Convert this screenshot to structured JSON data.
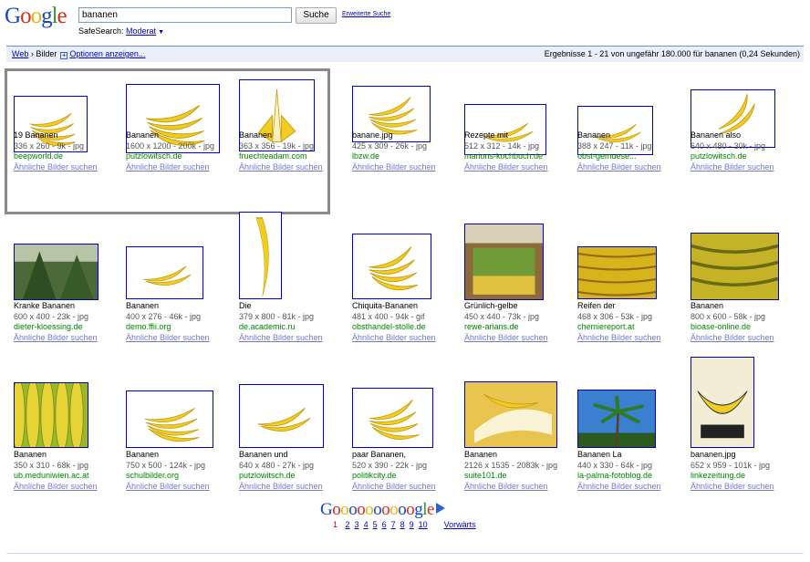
{
  "header": {
    "logo_letters": [
      {
        "ch": "G",
        "color": "#1548c8"
      },
      {
        "ch": "o",
        "color": "#d92a1e"
      },
      {
        "ch": "o",
        "color": "#e8b409"
      },
      {
        "ch": "g",
        "color": "#1548c8"
      },
      {
        "ch": "l",
        "color": "#2a9d2a"
      },
      {
        "ch": "e",
        "color": "#d92a1e"
      }
    ],
    "search_value": "bananen",
    "search_button": "Suche",
    "advanced_link": "Erweiterte Suche",
    "safesearch_label": "SafeSearch: ",
    "safesearch_value": "Moderat"
  },
  "bar": {
    "web_link": "Web",
    "separator": " › ",
    "current": "Bilder",
    "options_link": "Optionen anzeigen...",
    "results_info": "Ergebnisse 1 - 21 von ungefähr 180.000 für bananen (0,24 Sekunden)"
  },
  "results": [
    {
      "title": "19 Bananen",
      "meta": "336 x 260 - 9k - jpg",
      "site": "beepworld.de",
      "similar": "Ähnliche Bilder suchen"
    },
    {
      "title": "Bananen",
      "meta": "1600 x 1200 - 200k - jpg",
      "site": "putzlowitsch.de",
      "similar": "Ähnliche Bilder suchen"
    },
    {
      "title": "Bananen",
      "meta": "363 x 356 - 19k - jpg",
      "site": "fruechteadam.com",
      "similar": "Ähnliche Bilder suchen"
    },
    {
      "title": "banane.jpg",
      "meta": "425 x 309 - 26k - jpg",
      "site": "lbzw.de",
      "similar": "Ähnliche Bilder suchen"
    },
    {
      "title": "Rezepte mit",
      "meta": "512 x 312 - 14k - jpg",
      "site": "marions-kochbuch.de",
      "similar": "Ähnliche Bilder suchen"
    },
    {
      "title": "Bananen",
      "meta": "388 x 247 - 11k - jpg",
      "site": "obst-gemuese...",
      "similar": "Ähnliche Bilder suchen"
    },
    {
      "title": "Bananen also",
      "meta": "640 x 480 - 30k - jpg",
      "site": "putzlowitsch.de",
      "similar": "Ähnliche Bilder suchen"
    },
    {
      "title": "Kranke Bananen",
      "meta": "600 x 400 - 23k - jpg",
      "site": "dieter-kloessing.de",
      "similar": "Ähnliche Bilder suchen"
    },
    {
      "title": "Bananen",
      "meta": "400 x 276 - 46k - jpg",
      "site": "demo.ffii.org",
      "similar": "Ähnliche Bilder suchen"
    },
    {
      "title": "Die",
      "meta": "379 x 800 - 81k - jpg",
      "site": "de.academic.ru",
      "similar": "Ähnliche Bilder suchen"
    },
    {
      "title": "Chiquita-Bananen",
      "meta": "481 x 400 - 94k - gif",
      "site": "obsthandel-stolle.de",
      "similar": "Ähnliche Bilder suchen"
    },
    {
      "title": "Grünlich-gelbe",
      "meta": "450 x 440 - 73k - jpg",
      "site": "rewe-arians.de",
      "similar": "Ähnliche Bilder suchen"
    },
    {
      "title": "Reifen der",
      "meta": "468 x 306 - 53k - jpg",
      "site": "chemiereport.at",
      "similar": "Ähnliche Bilder suchen"
    },
    {
      "title": "Bananen",
      "meta": "800 x 600 - 58k - jpg",
      "site": "bioase-online.de",
      "similar": "Ähnliche Bilder suchen"
    },
    {
      "title": "Bananen",
      "meta": "350 x 310 - 68k - jpg",
      "site": "ub.meduniwien.ac.at",
      "similar": "Ähnliche Bilder suchen"
    },
    {
      "title": "Bananen",
      "meta": "750 x 500 - 124k - jpg",
      "site": "schulbilder.org",
      "similar": "Ähnliche Bilder suchen"
    },
    {
      "title": "Bananen und",
      "meta": "640 x 480 - 27k - jpg",
      "site": "putzlowitsch.de",
      "similar": "Ähnliche Bilder suchen"
    },
    {
      "title": "paar Bananen,",
      "meta": "520 x 390 - 22k - jpg",
      "site": "politikcity.de",
      "similar": "Ähnliche Bilder suchen"
    },
    {
      "title": "Bananen",
      "meta": "2126 x 1535 - 2083k - jpg",
      "site": "suite101.de",
      "similar": "Ähnliche Bilder suchen"
    },
    {
      "title": "Bananen La",
      "meta": "440 x 330 - 64k - jpg",
      "site": "la-palma-fotoblog.de",
      "similar": "Ähnliche Bilder suchen"
    },
    {
      "title": "bananen.jpg",
      "meta": "652 x 959 - 101k - jpg",
      "site": "linkezeitung.de",
      "similar": "Ähnliche Bilder suchen"
    }
  ],
  "pager": {
    "letters": [
      {
        "ch": "G",
        "color": "#1548c8"
      },
      {
        "ch": "o",
        "color": "#d92a1e"
      },
      {
        "ch": "o",
        "color": "#e8b409"
      },
      {
        "ch": "o",
        "color": "#1548c8"
      },
      {
        "ch": "o",
        "color": "#d92a1e"
      },
      {
        "ch": "o",
        "color": "#e8b409"
      },
      {
        "ch": "o",
        "color": "#1548c8"
      },
      {
        "ch": "o",
        "color": "#d92a1e"
      },
      {
        "ch": "o",
        "color": "#e8b409"
      },
      {
        "ch": "o",
        "color": "#1548c8"
      },
      {
        "ch": "o",
        "color": "#d92a1e"
      },
      {
        "ch": "g",
        "color": "#1548c8"
      },
      {
        "ch": "l",
        "color": "#2a9d2a"
      },
      {
        "ch": "e",
        "color": "#d92a1e"
      }
    ],
    "current_page": "1",
    "pages": [
      "2",
      "3",
      "4",
      "5",
      "6",
      "7",
      "8",
      "9",
      "10"
    ],
    "next_label": "Vorwärts"
  }
}
